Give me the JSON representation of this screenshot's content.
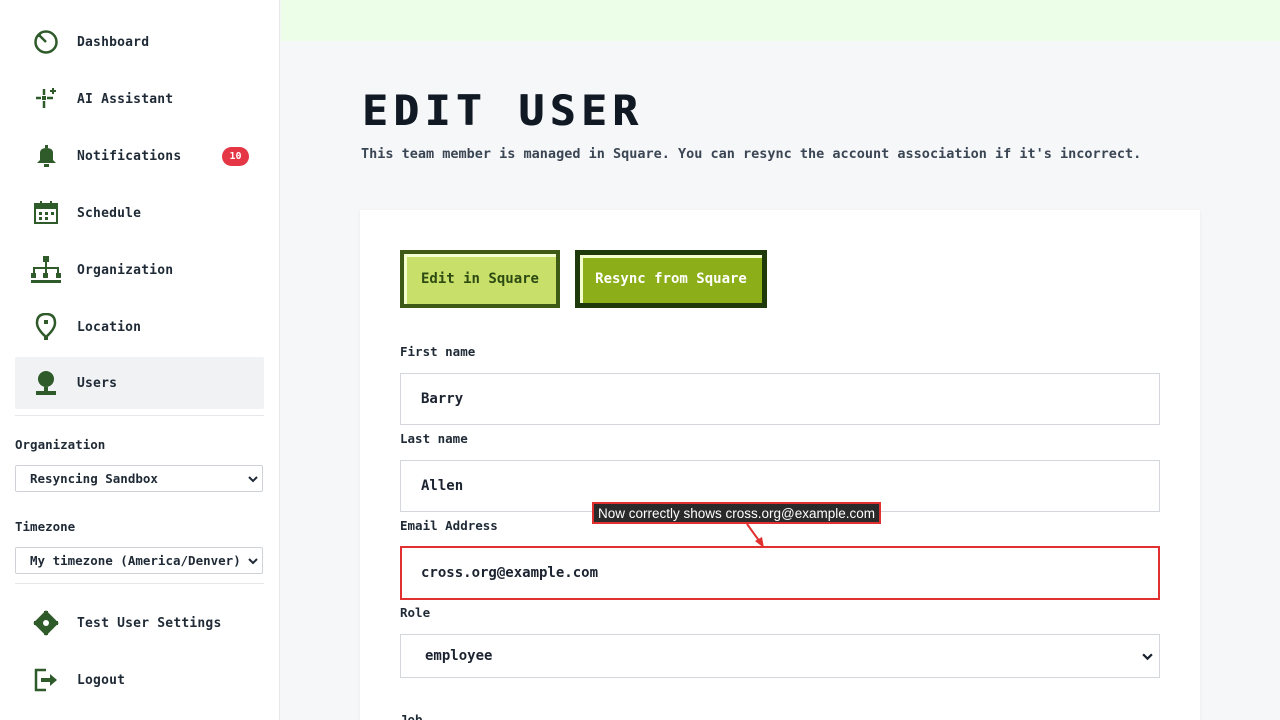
{
  "sidebar": {
    "items": [
      {
        "label": "Dashboard",
        "icon": "dashboard-gauge-icon"
      },
      {
        "label": "AI Assistant",
        "icon": "sparkle-icon"
      },
      {
        "label": "Notifications",
        "icon": "bell-icon",
        "badge": "10"
      },
      {
        "label": "Schedule",
        "icon": "calendar-icon"
      },
      {
        "label": "Organization",
        "icon": "org-chart-icon"
      },
      {
        "label": "Location",
        "icon": "map-pin-icon"
      },
      {
        "label": "Users",
        "icon": "user-icon",
        "active": true
      }
    ],
    "organization_label": "Organization",
    "organization_value": "Resyncing Sandbox",
    "timezone_label": "Timezone",
    "timezone_value": "My timezone (America/Denver)",
    "bottom_items": [
      {
        "label": "Test User Settings",
        "icon": "gear-icon"
      },
      {
        "label": "Logout",
        "icon": "logout-icon"
      }
    ]
  },
  "main": {
    "title": "EDIT USER",
    "subtitle": "This team member is managed in Square. You can resync the account association if it's incorrect.",
    "buttons": {
      "edit": "Edit in Square",
      "resync": "Resync from Square"
    },
    "form": {
      "first_name_label": "First name",
      "first_name_value": "Barry",
      "last_name_label": "Last name",
      "last_name_value": "Allen",
      "email_label": "Email Address",
      "email_value": "cross.org@example.com",
      "role_label": "Role",
      "role_value": "employee",
      "next_label": "Job"
    }
  },
  "annotation": {
    "text": "Now correctly shows cross.org@example.com"
  },
  "colors": {
    "accent_dark_green": "#2f5a2a",
    "badge_red": "#e53645",
    "highlight_red": "#e0302f",
    "button_light": "#c8e06a",
    "button_dark": "#8cae18"
  }
}
